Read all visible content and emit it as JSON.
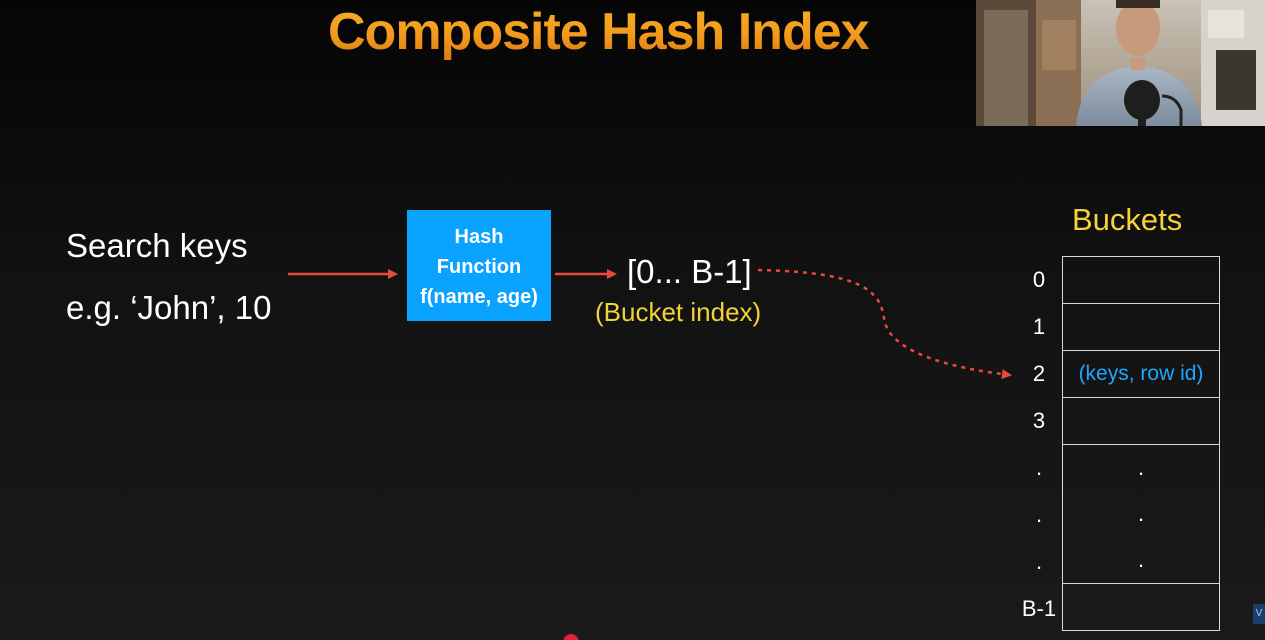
{
  "slide": {
    "title": "Composite Hash Index",
    "search_keys_label": "Search keys",
    "example_label": "e.g. ‘John’, 10",
    "hash_function": {
      "line1": "Hash",
      "line2": "Function",
      "line3": "f(name, age)"
    },
    "range_label": "[0... B-1]",
    "bucket_index_label": "(Bucket index)",
    "buckets_title": "Buckets",
    "bucket_labels": [
      "0",
      "1",
      "2",
      "3",
      ".",
      ".",
      ".",
      "B-1"
    ],
    "bucket_contents": [
      "",
      "",
      "(keys, row id)",
      "",
      ".",
      ".",
      ".",
      ""
    ]
  },
  "colors": {
    "title_gradient_top": "#f7b02a",
    "title_gradient_bottom": "#d97a12",
    "hash_box": "#0aa2ff",
    "arrow": "#e84b3c",
    "yellow_text": "#f3d23a",
    "blue_text": "#1fa6ff"
  },
  "webcam": {
    "description_icon": "presenter-video"
  }
}
